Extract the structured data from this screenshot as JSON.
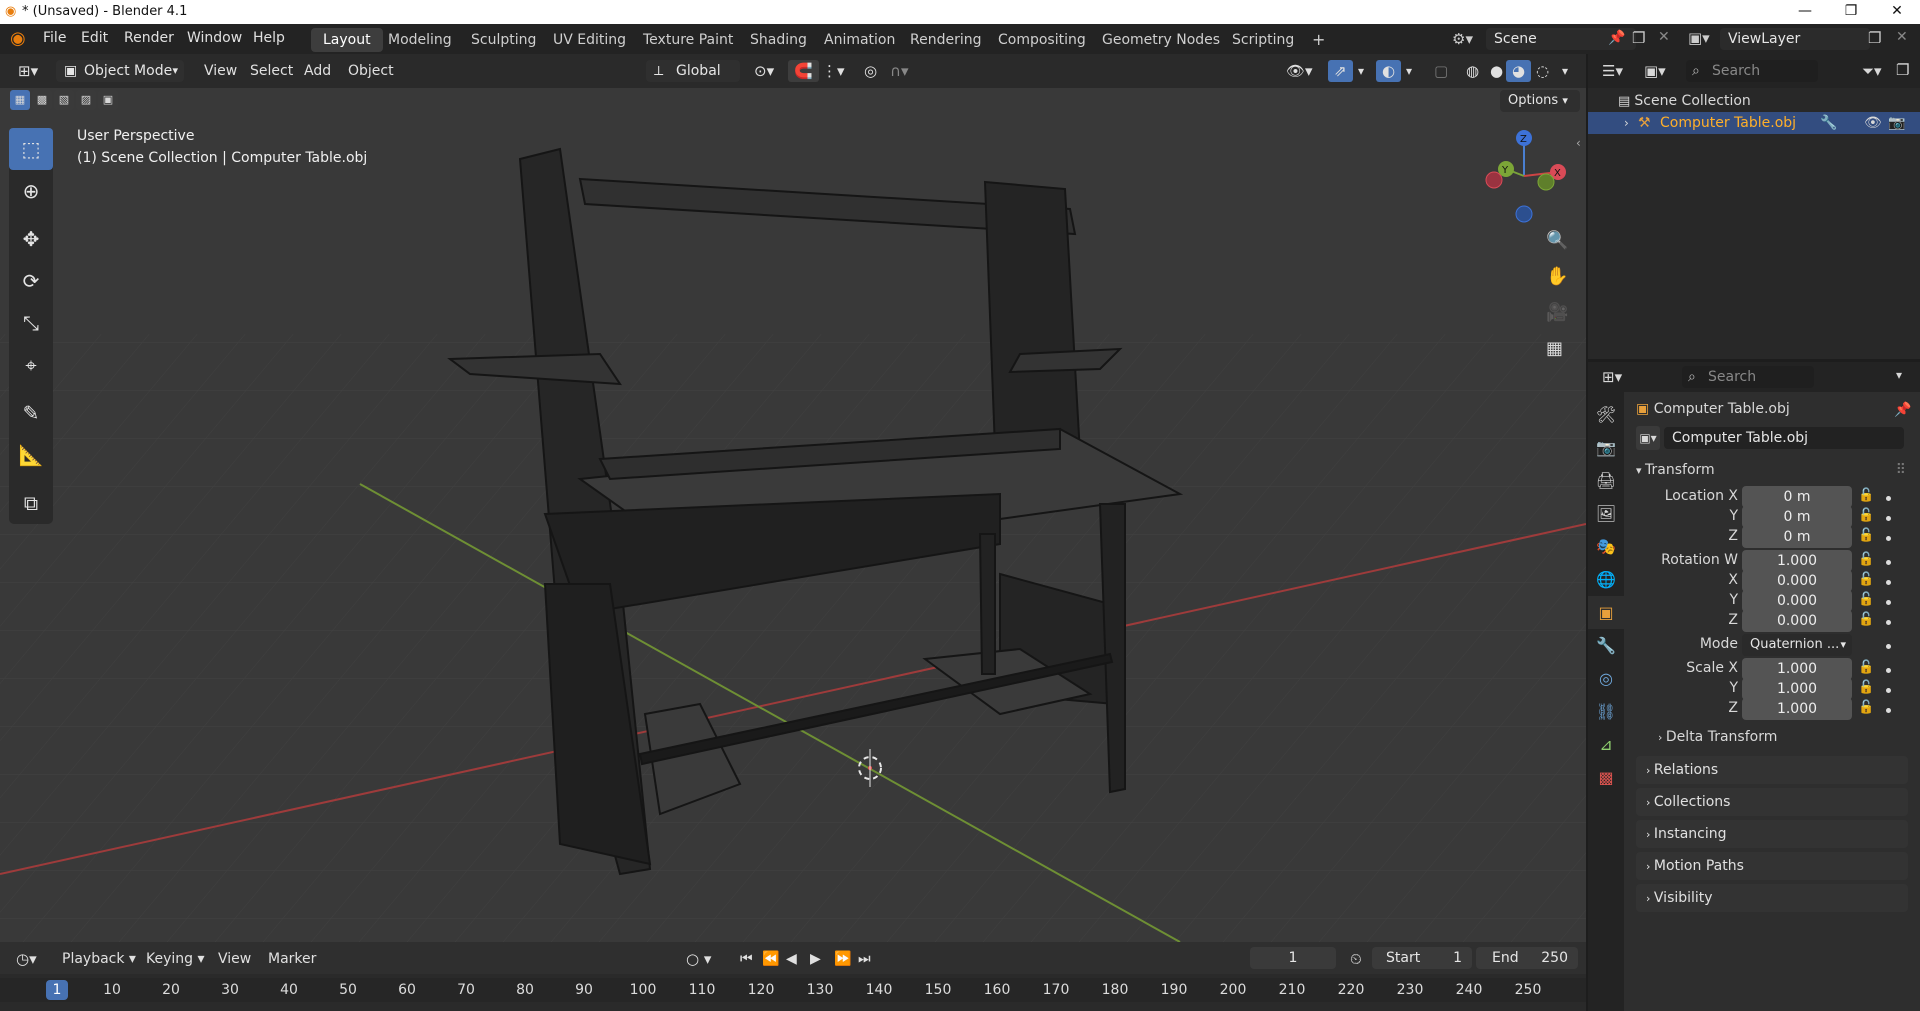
{
  "window": {
    "title": "* (Unsaved) - Blender 4.1",
    "controls": [
      "minimize",
      "maximize",
      "close"
    ]
  },
  "menubar": {
    "items": [
      "File",
      "Edit",
      "Render",
      "Window",
      "Help"
    ]
  },
  "workspaces": {
    "tabs": [
      "Layout",
      "Modeling",
      "Sculpting",
      "UV Editing",
      "Texture Paint",
      "Shading",
      "Animation",
      "Rendering",
      "Compositing",
      "Geometry Nodes",
      "Scripting"
    ],
    "active": "Layout",
    "add": "+"
  },
  "scene": {
    "name": "Scene",
    "view_layer": "ViewLayer"
  },
  "viewport_header": {
    "mode": "Object Mode",
    "menus": [
      "View",
      "Select",
      "Add",
      "Object"
    ],
    "orientation": "Global",
    "options": "Options"
  },
  "viewport": {
    "perspective_label": "User Perspective",
    "collection_label": "(1) Scene Collection | Computer Table.obj",
    "gizmo_axes": [
      "Z",
      "Y",
      "X"
    ],
    "grid_color": "#444444",
    "x_axis_color": "#b64444",
    "y_axis_color": "#7fa33a",
    "background": "#393939"
  },
  "toolbar": {
    "tools": [
      "select-box-icon",
      "cursor-icon",
      "move-icon",
      "rotate-icon",
      "scale-icon",
      "transform-icon",
      "annotate-icon",
      "measure-icon",
      "add-cube-icon"
    ],
    "active": 0
  },
  "outliner": {
    "search_placeholder": "Search",
    "root": "Scene Collection",
    "items": [
      {
        "name": "Computer Table.obj",
        "selected": true
      }
    ]
  },
  "properties": {
    "search_placeholder": "Search",
    "object_name": "Computer Table.obj",
    "data_name": "Computer Table.obj",
    "transform_label": "Transform",
    "location": {
      "label": "Location X",
      "x": "0 m",
      "y": "0 m",
      "z": "0 m"
    },
    "rotation": {
      "label": "Rotation W",
      "w": "1.000",
      "x": "0.000",
      "y": "0.000",
      "z": "0.000"
    },
    "mode": {
      "label": "Mode",
      "value": "Quaternion ..."
    },
    "scale": {
      "label": "Scale X",
      "x": "1.000",
      "y": "1.000",
      "z": "1.000"
    },
    "axis_labels": {
      "x": "X",
      "y": "Y",
      "z": "Z"
    },
    "delta_transform": "Delta Transform",
    "sections": [
      "Relations",
      "Collections",
      "Instancing",
      "Motion Paths",
      "Visibility"
    ]
  },
  "timeline": {
    "menus": [
      "Playback",
      "Keying",
      "View",
      "Marker"
    ],
    "current_frame": "1",
    "start_label": "Start",
    "start": "1",
    "end_label": "End",
    "end": "250",
    "ruler_ticks": [
      "1",
      "10",
      "20",
      "30",
      "40",
      "50",
      "60",
      "70",
      "80",
      "90",
      "100",
      "110",
      "120",
      "130",
      "140",
      "150",
      "160",
      "170",
      "180",
      "190",
      "200",
      "210",
      "220",
      "230",
      "240",
      "250"
    ]
  }
}
